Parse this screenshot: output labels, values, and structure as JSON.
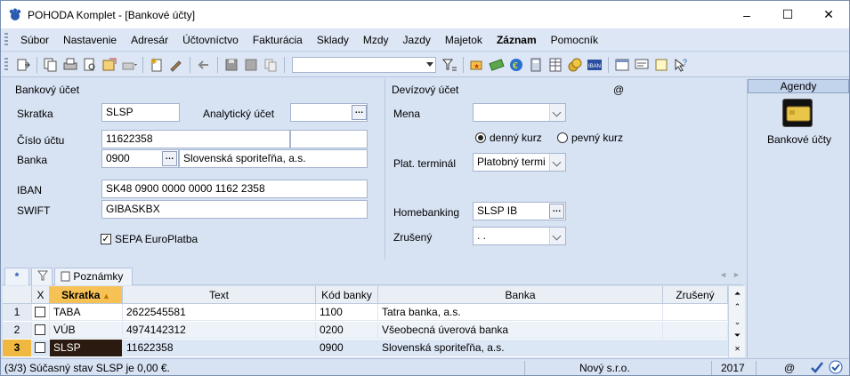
{
  "window": {
    "title": "POHODA Komplet - [Bankové účty]",
    "controls": [
      "–",
      "☐",
      "✕"
    ]
  },
  "menu": [
    "Súbor",
    "Nastavenie",
    "Adresár",
    "Účtovníctvo",
    "Fakturácia",
    "Sklady",
    "Mzdy",
    "Jazdy",
    "Majetok",
    "Záznam",
    "Pomocník"
  ],
  "form": {
    "section_left": "Bankový účet",
    "section_right": "Devízový účet",
    "at_sign": "@",
    "skratka_label": "Skratka",
    "skratka_value": "SLSP",
    "analyticky_label": "Analytický účet",
    "analyticky_value": "",
    "cislo_label": "Číslo účtu",
    "cislo_value": "11622358",
    "banka_label": "Banka",
    "banka_code": "0900",
    "banka_name": "Slovenská sporiteľňa, a.s.",
    "iban_label": "IBAN",
    "iban_value": "SK48 0900 0000 0000 1162 2358",
    "swift_label": "SWIFT",
    "swift_value": "GIBASKBX",
    "sepa_label": "SEPA EuroPlatba",
    "sepa_checked": true,
    "mena_label": "Mena",
    "mena_value": "",
    "kurz_denny": "denný kurz",
    "kurz_pevny": "pevný kurz",
    "kurz_selected": "denný kurz",
    "terminal_label": "Plat. terminál",
    "terminal_value": "Platobný termi",
    "homebanking_label": "Homebanking",
    "homebanking_value": "SLSP IB",
    "zruseny_label": "Zrušený",
    "zruseny_value": " .  ."
  },
  "sidebar": {
    "header": "Agendy",
    "item_label": "Bankové účty"
  },
  "tabs": {
    "star": "*",
    "notes": "Poznámky"
  },
  "table": {
    "columns": [
      "X",
      "Skratka",
      "Text",
      "Kód banky",
      "Banka",
      "Zrušený"
    ],
    "rows": [
      {
        "num": "1",
        "x": false,
        "skratka": "TABA",
        "text": "2622545581",
        "kod": "1100",
        "banka": "Tatra banka, a.s.",
        "zruseny": ""
      },
      {
        "num": "2",
        "x": false,
        "skratka": "VÚB",
        "text": "4974142312",
        "kod": "0200",
        "banka": "Všeobecná úverová banka",
        "zruseny": ""
      },
      {
        "num": "3",
        "x": false,
        "skratka": "SLSP",
        "text": "11622358",
        "kod": "0900",
        "banka": "Slovenská sporiteľňa, a.s.",
        "zruseny": ""
      }
    ]
  },
  "status": {
    "message": "(3/3) Súčasný stav SLSP je 0,00 €.",
    "company": "Nový s.r.o.",
    "year": "2017",
    "at": "@"
  },
  "colors": {
    "accent": "#f7c255",
    "selected_row_num": "#f0b840",
    "selected_cell": "#2b1a0f"
  }
}
